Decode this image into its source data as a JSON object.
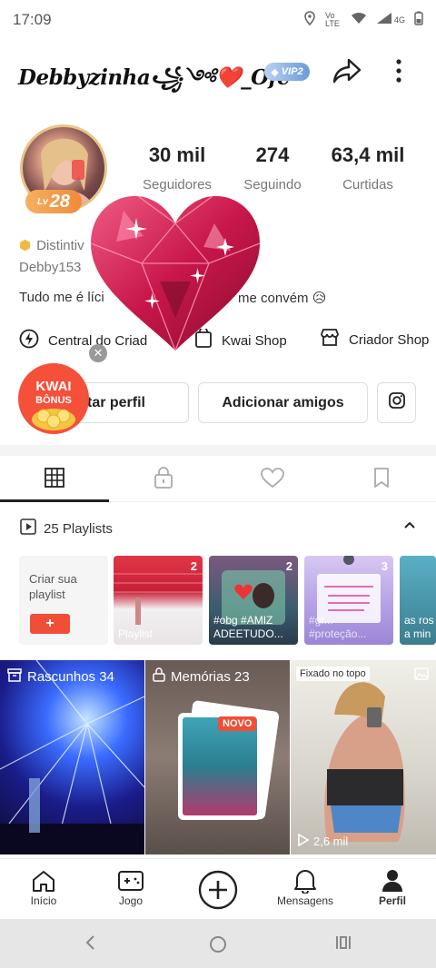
{
  "status": {
    "time": "17:09",
    "carrier": "Vo LTE",
    "net": "4G"
  },
  "profile": {
    "name": "Debbyzinha꧁༺❤️_Ofc",
    "vip": "VIP2",
    "level": "28",
    "stats": [
      {
        "value": "30 mil",
        "label": "Seguidores"
      },
      {
        "value": "274",
        "label": "Seguindo"
      },
      {
        "value": "63,4 mil",
        "label": "Curtidas"
      }
    ],
    "badge": "Distintiv",
    "kwai_id": "Debby153",
    "bio_left": "Tudo me é líci",
    "bio_right": "me convém 😥"
  },
  "shops": [
    {
      "label": "Central do Criad"
    },
    {
      "label": "Kwai Shop"
    },
    {
      "label": "Criador Shop"
    }
  ],
  "buttons": {
    "edit": "tar perfil",
    "add_friends": "Adicionar amigos"
  },
  "kwai_bonus": {
    "line1": "KWAI",
    "line2": "BÔNUS"
  },
  "playlists": {
    "header": "25 Playlists",
    "create_label_1": "Criar sua",
    "create_label_2": "playlist",
    "items": [
      {
        "count": "2",
        "caption": "Playlist"
      },
      {
        "count": "2",
        "caption": "#obg #AMIZ ADEETUDO..."
      },
      {
        "count": "3",
        "caption": "#gr... #proteção..."
      },
      {
        "count": "",
        "caption": "as ros a min"
      }
    ]
  },
  "grid": {
    "drafts": "Rascunhos 34",
    "memories": "Memórias 23",
    "novo": "NOVO",
    "pinned": "Fixado no topo",
    "views": "2,6 mil"
  },
  "nav": [
    {
      "label": "Início"
    },
    {
      "label": "Jogo"
    },
    {
      "label": ""
    },
    {
      "label": "Mensagens"
    },
    {
      "label": "Perfil"
    }
  ]
}
